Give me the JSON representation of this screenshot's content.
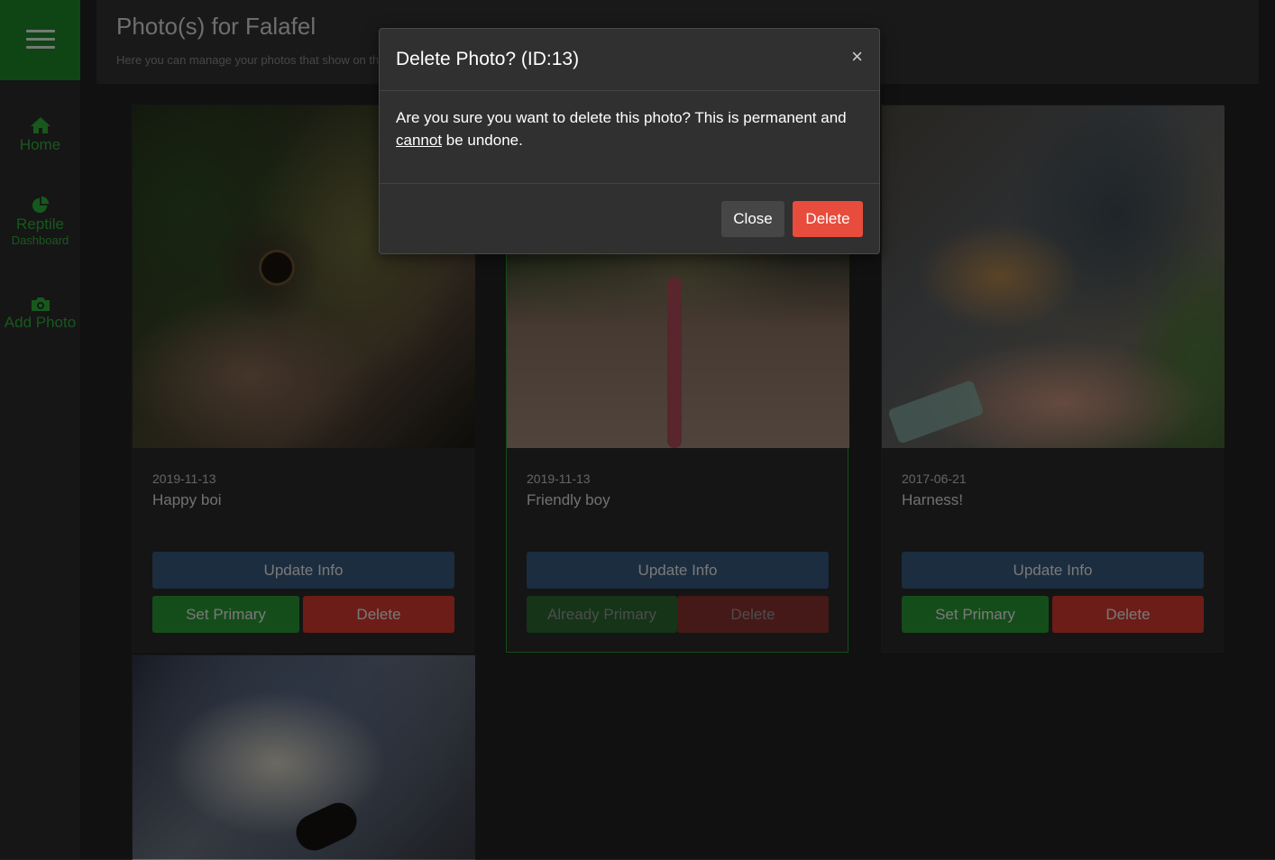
{
  "header": {
    "title": "Photo(s) for Falafel",
    "subtitle": "Here you can manage your photos that show on thi"
  },
  "sidebar": {
    "items": [
      {
        "label": "Home",
        "icon": "home-icon"
      },
      {
        "label": "Reptile",
        "sublabel": "Dashboard",
        "icon": "pie-chart-icon"
      },
      {
        "label": "Add Photo",
        "icon": "camera-icon"
      }
    ]
  },
  "cards": [
    {
      "date": "2019-11-13",
      "caption": "Happy boi",
      "update_label": "Update Info",
      "primary_label": "Set Primary",
      "delete_label": "Delete",
      "is_primary": false
    },
    {
      "date": "2019-11-13",
      "caption": "Friendly boy",
      "update_label": "Update Info",
      "primary_label": "Already Primary",
      "delete_label": "Delete",
      "is_primary": true
    },
    {
      "date": "2017-06-21",
      "caption": "Harness!",
      "update_label": "Update Info",
      "primary_label": "Set Primary",
      "delete_label": "Delete",
      "is_primary": false
    }
  ],
  "modal": {
    "title": "Delete Photo? (ID:13)",
    "close_x": "×",
    "body_start": "Are you sure you want to delete this photo? This is permanent and",
    "body_emphasis": "cannot",
    "body_end": " be undone.",
    "close_label": "Close",
    "delete_label": "Delete"
  },
  "colors": {
    "accent_green": "#2b9a35",
    "info_blue": "#375a7f",
    "danger_red": "#d93a31",
    "modal_delete": "#e74c3c"
  }
}
